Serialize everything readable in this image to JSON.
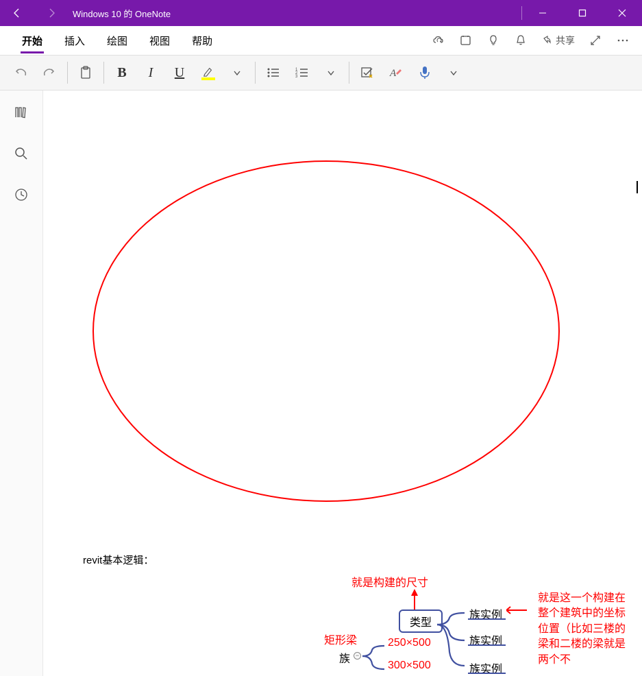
{
  "title": "Windows 10 的 OneNote",
  "menu": {
    "start": "开始",
    "insert": "插入",
    "draw": "绘图",
    "view": "视图",
    "help": "帮助",
    "share": "共享"
  },
  "content": {
    "logic_title": "revit基本逻辑：",
    "diagram": {
      "dimension_note": "就是构建的尺寸",
      "type_label": "类型",
      "rect_beam": "矩形梁",
      "family": "族",
      "dim1": "250×500",
      "dim2": "300×500",
      "instance1": "族实例",
      "instance2": "族实例",
      "instance3": "族实例",
      "big_note": "就是这一个构建在整个建筑中的坐标位置（比如三楼的梁和二楼的梁就是两个不"
    }
  }
}
